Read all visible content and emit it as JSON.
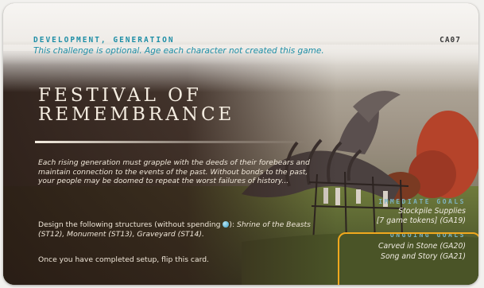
{
  "card": {
    "category": "DEVELOPMENT, GENERATION",
    "subtitle": "This challenge is optional. Age each character not created this game.",
    "id": "CA07",
    "title_line1": "FESTIVAL OF",
    "title_line2": "REMEMBRANCE",
    "flavor": "Each rising generation must grapple with the deeds of their forebears and maintain connection to the events of the past. Without bonds to the past, your people may be doomed to repeat the worst failures of history...",
    "instruction": {
      "prefix": "Design the following structures (without spending ",
      "middle": "): ",
      "structures": "Shrine of the Beasts (ST12), Monument (ST13), Graveyard (ST14).",
      "gem_icon": "resource-gem-icon"
    },
    "flip_text": "Once you have completed setup, flip this card."
  },
  "goals": {
    "immediate_heading": "IMMEDIATE GOALS",
    "immediate": [
      "Stockpile Supplies",
      "[7 game tokens] (GA19)"
    ],
    "ongoing_heading": "ONGOING GOALS",
    "ongoing": [
      "Carved in Stone (GA20)",
      "Song and Story (GA21)"
    ]
  },
  "colors": {
    "accent": "#1e8ea6",
    "highlight": "#f0a81e",
    "card_text": "#efe6d8"
  }
}
